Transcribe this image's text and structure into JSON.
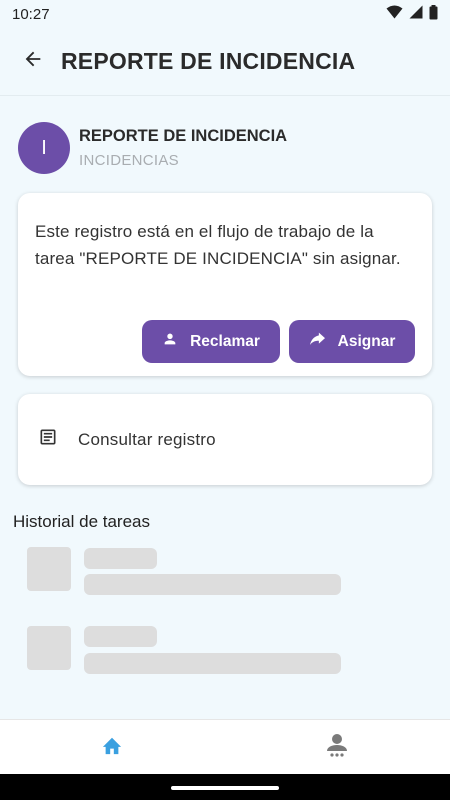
{
  "status_bar": {
    "time": "10:27",
    "icons": [
      "wifi-icon",
      "signal-icon",
      "battery-icon"
    ]
  },
  "app_bar": {
    "title": "REPORTE DE INCIDENCIA",
    "back_icon": "arrow-left-icon"
  },
  "record": {
    "avatar_letter": "I",
    "title": "REPORTE DE INCIDENCIA",
    "subtitle": "INCIDENCIAS"
  },
  "workflow_card": {
    "message": "Este registro está en el flujo de trabajo de la tarea \"REPORTE DE INCIDENCIA\" sin asignar.",
    "claim_label": "Reclamar",
    "claim_icon": "person-icon",
    "assign_label": "Asignar",
    "assign_icon": "forward-arrow-icon"
  },
  "consult_card": {
    "label": "Consultar registro",
    "icon": "document-icon"
  },
  "history": {
    "title": "Historial de tareas"
  },
  "bottom_nav": {
    "items": [
      {
        "icon": "home-icon",
        "active": true
      },
      {
        "icon": "user-menu-icon",
        "active": false
      }
    ]
  },
  "colors": {
    "background": "#f1f9fd",
    "primary": "#6c4ea8",
    "active_nav": "#3aa0e0",
    "inactive_nav": "#7a7a7a",
    "skeleton": "#dddddd"
  }
}
